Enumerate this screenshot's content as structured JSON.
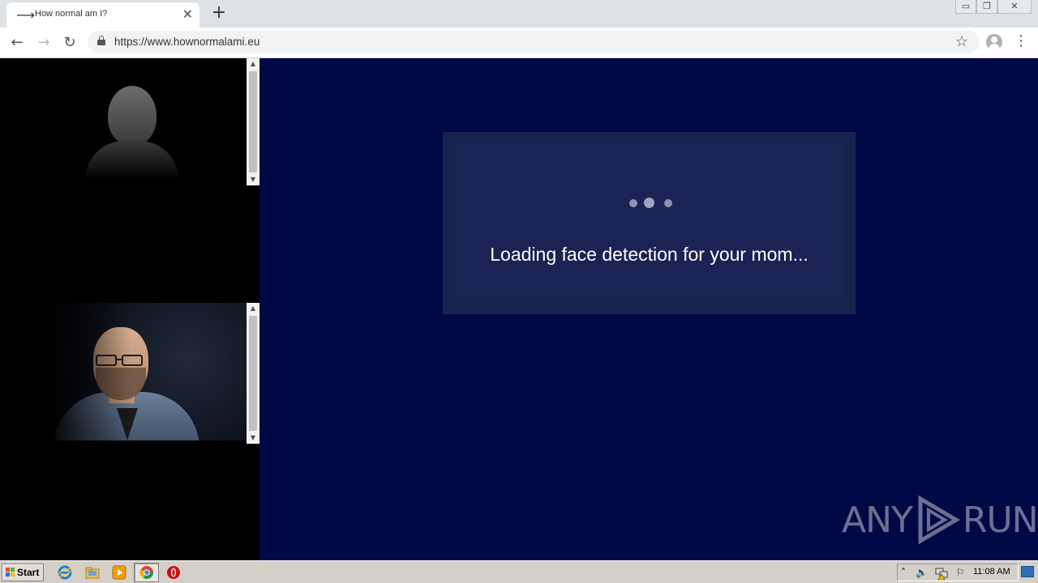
{
  "browser": {
    "tab": {
      "title": "How normal am I?",
      "favicon": "arrow-right-icon",
      "close_glyph": "✕"
    },
    "new_tab_glyph": "+",
    "window_controls": {
      "minimize": "▭",
      "restore": "❐",
      "close": "✕"
    },
    "nav": {
      "back": "←",
      "forward": "→",
      "reload": "↻"
    },
    "url": "https://www.hownormalami.eu",
    "bookmark_glyph": "☆",
    "menu_glyph": "⋮"
  },
  "page": {
    "loading_text": "Loading face detection for your mom...",
    "colors": {
      "background": "#000845",
      "box": "#19224f",
      "panel": "#000000"
    },
    "watermark": {
      "left": "ANY",
      "right": "RUN"
    }
  },
  "taskbar": {
    "start_label": "Start",
    "pinned": [
      "internet-explorer-icon",
      "file-explorer-icon",
      "media-player-icon",
      "chrome-icon",
      "opera-icon"
    ],
    "tray": {
      "expand_glyph": "˄",
      "volume_glyph": "🔈",
      "flag_glyph": "⚐"
    },
    "clock": "11:08 AM"
  }
}
